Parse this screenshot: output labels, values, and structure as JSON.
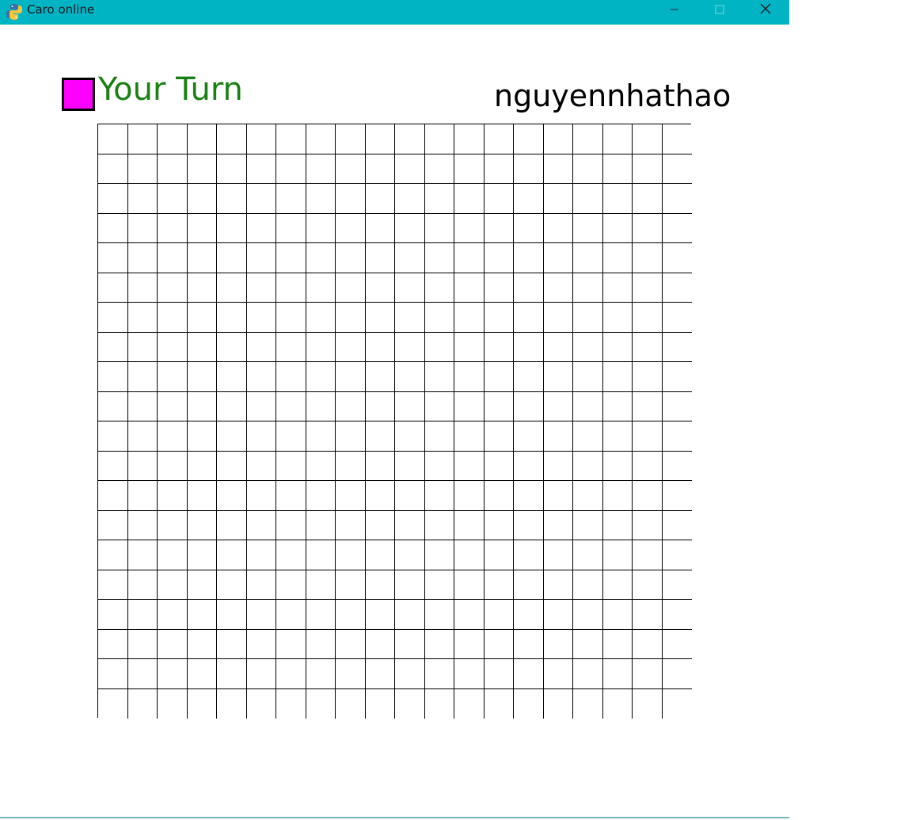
{
  "window": {
    "title": "Caro online",
    "icon": "python-snake-icon"
  },
  "status": {
    "turn_text": "Your Turn",
    "turn_color": "#1a7f14",
    "player_marker_color": "#ff00ff"
  },
  "player": {
    "name": "nguyennhathao"
  },
  "board": {
    "rows": 20,
    "cols": 20,
    "cells": []
  }
}
